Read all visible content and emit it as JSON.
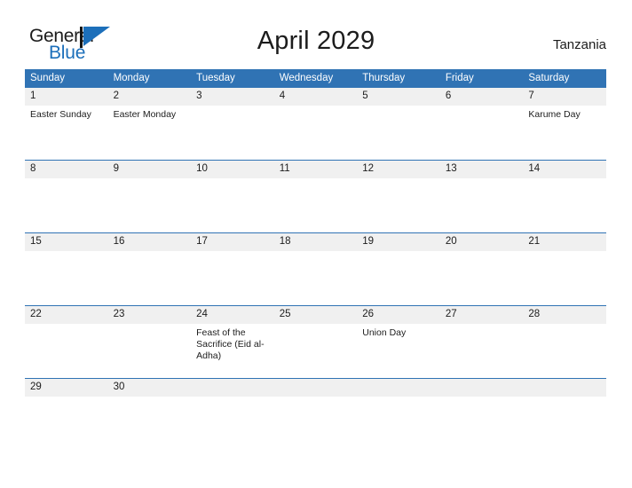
{
  "brand": {
    "name_part1": "General",
    "name_part2": "Blue",
    "mark": "triangle-flag-icon"
  },
  "header": {
    "title": "April 2029",
    "country": "Tanzania"
  },
  "colors": {
    "header_blue": "#3073b4",
    "brand_blue": "#1c6fba",
    "daynum_background": "#f0f0f0",
    "text": "#1c1c1c"
  },
  "calendar": {
    "month": "April",
    "year": "2029",
    "weekday_headers": [
      "Sunday",
      "Monday",
      "Tuesday",
      "Wednesday",
      "Thursday",
      "Friday",
      "Saturday"
    ],
    "weeks": [
      {
        "days": [
          {
            "number": "1",
            "events": [
              "Easter Sunday"
            ]
          },
          {
            "number": "2",
            "events": [
              "Easter Monday"
            ]
          },
          {
            "number": "3",
            "events": []
          },
          {
            "number": "4",
            "events": []
          },
          {
            "number": "5",
            "events": []
          },
          {
            "number": "6",
            "events": []
          },
          {
            "number": "7",
            "events": [
              "Karume Day"
            ]
          }
        ]
      },
      {
        "days": [
          {
            "number": "8",
            "events": []
          },
          {
            "number": "9",
            "events": []
          },
          {
            "number": "10",
            "events": []
          },
          {
            "number": "11",
            "events": []
          },
          {
            "number": "12",
            "events": []
          },
          {
            "number": "13",
            "events": []
          },
          {
            "number": "14",
            "events": []
          }
        ]
      },
      {
        "days": [
          {
            "number": "15",
            "events": []
          },
          {
            "number": "16",
            "events": []
          },
          {
            "number": "17",
            "events": []
          },
          {
            "number": "18",
            "events": []
          },
          {
            "number": "19",
            "events": []
          },
          {
            "number": "20",
            "events": []
          },
          {
            "number": "21",
            "events": []
          }
        ]
      },
      {
        "days": [
          {
            "number": "22",
            "events": []
          },
          {
            "number": "23",
            "events": []
          },
          {
            "number": "24",
            "events": [
              "Feast of the Sacrifice (Eid al-Adha)"
            ]
          },
          {
            "number": "25",
            "events": []
          },
          {
            "number": "26",
            "events": [
              "Union Day"
            ]
          },
          {
            "number": "27",
            "events": []
          },
          {
            "number": "28",
            "events": []
          }
        ]
      },
      {
        "days": [
          {
            "number": "29",
            "events": []
          },
          {
            "number": "30",
            "events": []
          },
          {
            "number": "",
            "events": []
          },
          {
            "number": "",
            "events": []
          },
          {
            "number": "",
            "events": []
          },
          {
            "number": "",
            "events": []
          },
          {
            "number": "",
            "events": []
          }
        ]
      }
    ]
  }
}
